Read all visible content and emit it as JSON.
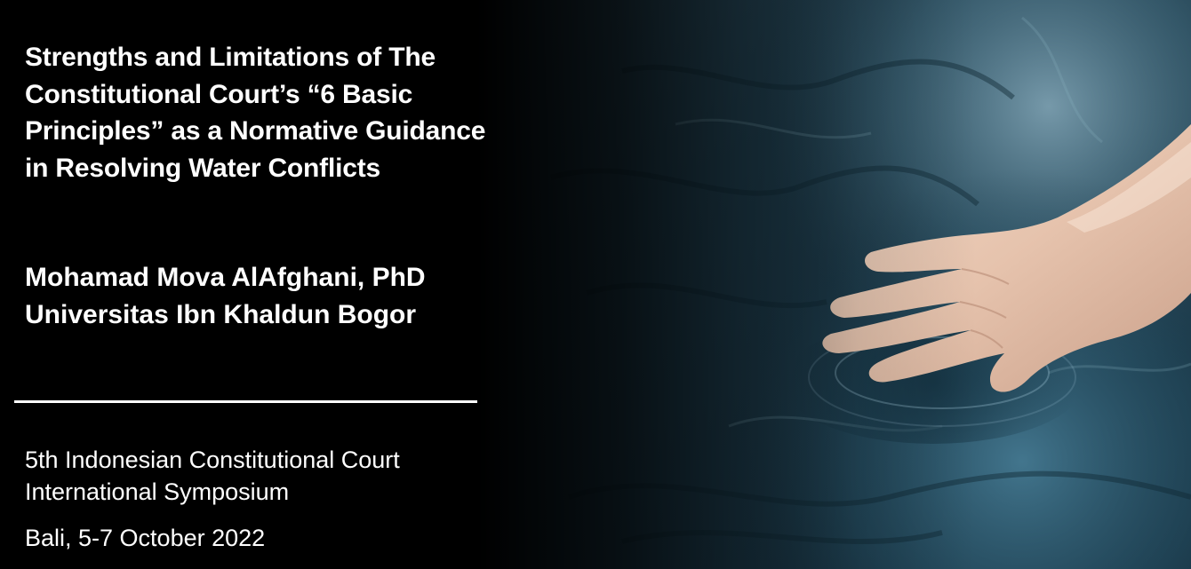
{
  "slide": {
    "title": "Strengths and Limitations of The Constitutional Court’s “6 Basic Principles” as a Normative Guidance in Resolving Water Conflicts",
    "author_name": "Mohamad Mova AlAfghani, PhD",
    "author_affiliation": "Universitas Ibn Khaldun Bogor",
    "event_line1": "5th Indonesian Constitutional Court",
    "event_line2": "International Symposium",
    "date": "Bali,  5-7 October 2022"
  },
  "background": {
    "image": "hand-touching-water",
    "colors": {
      "left_panel": "#000000",
      "water_dark": "#0b1a24",
      "water_mid": "#2a5468",
      "water_light": "#6f9bb0",
      "skin": "#e9c9b3",
      "text": "#ffffff"
    }
  }
}
